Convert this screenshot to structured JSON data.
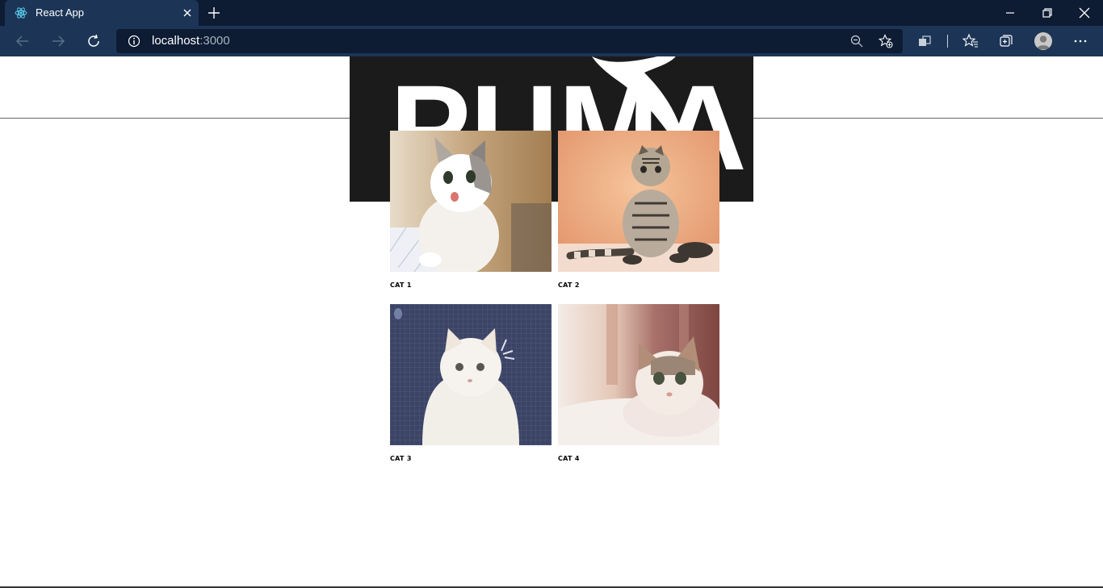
{
  "browser": {
    "tab": {
      "title": "React App"
    },
    "address": {
      "host": "localhost",
      "port": ":3000"
    }
  },
  "header": {
    "logo_text": "PUMA"
  },
  "gallery": {
    "items": [
      {
        "label": "CAT 1"
      },
      {
        "label": "CAT 2"
      },
      {
        "label": "CAT 3"
      },
      {
        "label": "CAT 4"
      }
    ]
  }
}
